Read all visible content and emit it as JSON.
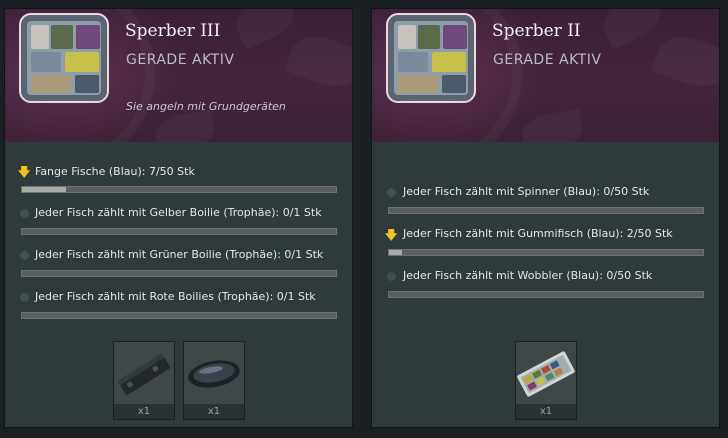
{
  "cards": [
    {
      "title": "Sperber III",
      "status": "GERADE AKTIV",
      "description": "Sie angeln mit Grundgeräten",
      "tasks": [
        {
          "label": "Fange Fische (Blau): 7/50 Stk",
          "progress": 0.14,
          "active": true
        },
        {
          "label": "Jeder Fisch zählt mit Gelber Boilie (Trophäe): 0/1 Stk",
          "progress": 0,
          "active": false
        },
        {
          "label": "Jeder Fisch zählt mit Grüner Boilie (Trophäe): 0/1 Stk",
          "progress": 0,
          "active": false
        },
        {
          "label": "Jeder Fisch zählt mit Rote Boilies (Trophäe): 0/1 Stk",
          "progress": 0,
          "active": false
        }
      ],
      "rewards": [
        {
          "qty": "x1",
          "item": "dark-case-icon"
        },
        {
          "qty": "x1",
          "item": "oval-tray-icon"
        }
      ]
    },
    {
      "title": "Sperber II",
      "status": "GERADE AKTIV",
      "description": "",
      "tasks": [
        {
          "label": "Jeder Fisch zählt mit Spinner (Blau): 0/50 Stk",
          "progress": 0,
          "active": false
        },
        {
          "label": "Jeder Fisch zählt mit Gummifisch (Blau): 2/50 Stk",
          "progress": 0.04,
          "active": true
        },
        {
          "label": "Jeder Fisch zählt mit Wobbler (Blau): 0/50 Stk",
          "progress": 0,
          "active": false
        }
      ],
      "rewards": [
        {
          "qty": "x1",
          "item": "lure-box-icon"
        }
      ]
    }
  ],
  "colors": {
    "panel": "#2f3a3c",
    "header": "#43243d",
    "active_arrow": "#f2c11b",
    "bar_fill": "#a9a9a6"
  }
}
